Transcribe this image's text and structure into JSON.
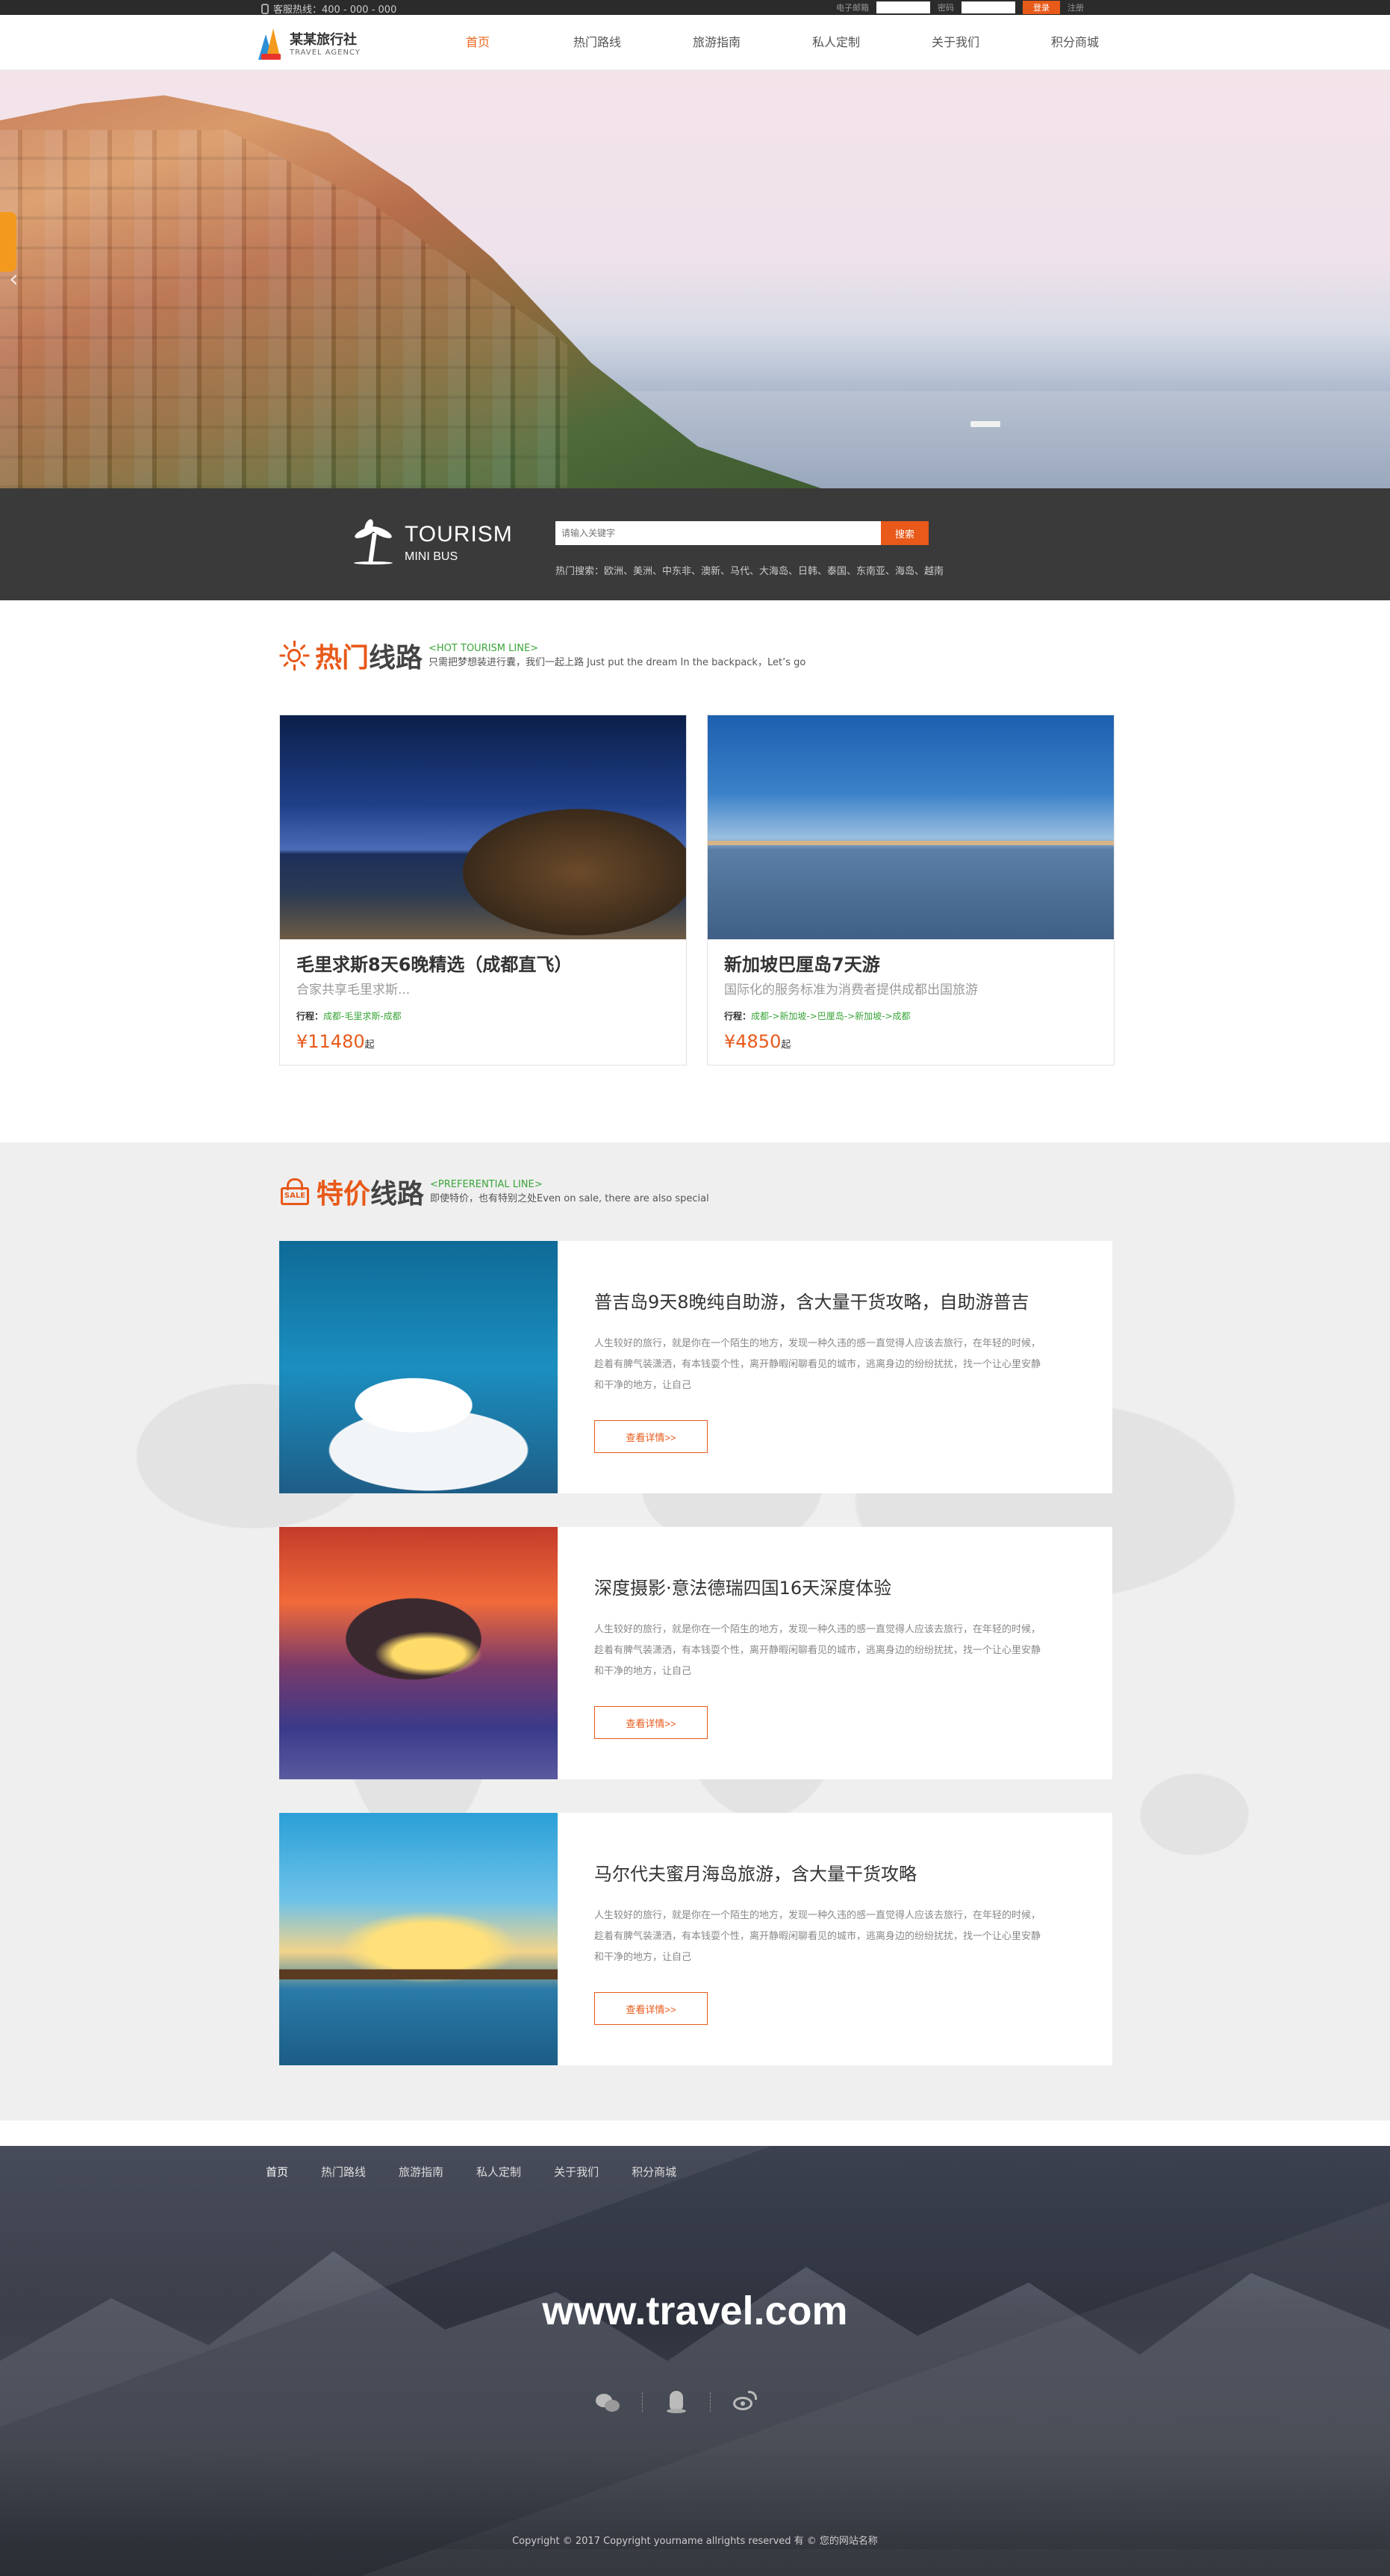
{
  "topbar": {
    "hotline": "客服热线：400 - 000 - 000",
    "email_label": "电子邮箱",
    "password_label": "密码",
    "login_label": "登录",
    "register_label": "注册"
  },
  "header": {
    "logo_cn": "某某旅行社",
    "logo_en": "TRAVEL AGENCY",
    "nav": [
      "首页",
      "热门路线",
      "旅游指南",
      "私人定制",
      "关于我们",
      "积分商城"
    ],
    "active_index": 0,
    "accent": "#e8681f"
  },
  "search": {
    "brand_title": "TOURISM",
    "brand_sub": "MINI BUS",
    "placeholder": "请输入关键字",
    "button": "搜索",
    "hot_label": "热门搜索：欧洲、美洲、中东非、澳新、马代、大海岛、日韩、泰国、东南亚、海岛、越南"
  },
  "hot_section": {
    "title_a": "热门",
    "title_b": "线路",
    "en": "<HOT TOURISM LINE>",
    "desc": "只需把梦想装进行囊，我们一起上路 Just put the dream In the backpack，Let’s go",
    "cards": [
      {
        "name": "毛里求斯8天6晚精选（成都直飞）",
        "desc": "合家共享毛里求斯...",
        "itin_label": "行程：",
        "itin": "成都-毛里求斯-成都",
        "price": "¥11480",
        "price_suffix": "起"
      },
      {
        "name": "新加坡巴厘岛7天游",
        "desc": "国际化的服务标准为消费者提供成都出国旅游",
        "itin_label": "行程：",
        "itin": "成都->新加坡->巴厘岛->新加坡->成都",
        "price": "¥4850",
        "price_suffix": "起"
      }
    ]
  },
  "pref_section": {
    "title_a": "特价",
    "title_b": "线路",
    "en": "<PREFERENTIAL LINE>",
    "desc": "即使特价，也有特别之处Even on sale, there are also special",
    "sale_badge": "SALE",
    "deals": [
      {
        "title": "普吉岛9天8晚纯自助游，含大量干货攻略，自助游普吉",
        "text": "人生较好的旅行，就是你在一个陌生的地方，发现一种久违的感一直觉得人应该去旅行，在年轻的时候，趁着有脾气装潇洒，有本钱耍个性，离开静暇闲聊看见的城市，逃离身边的纷纷扰扰，找一个让心里安静和干净的地方，让自己",
        "more": "查看详情>>"
      },
      {
        "title": "深度摄影·意法德瑞四国16天深度体验",
        "text": "人生较好的旅行，就是你在一个陌生的地方，发现一种久违的感一直觉得人应该去旅行，在年轻的时候，趁着有脾气装潇洒，有本钱耍个性，离开静暇闲聊看见的城市，逃离身边的纷纷扰扰，找一个让心里安静和干净的地方，让自己",
        "more": "查看详情>>"
      },
      {
        "title": "马尔代夫蜜月海岛旅游，含大量干货攻略",
        "text": "人生较好的旅行，就是你在一个陌生的地方，发现一种久违的感一直觉得人应该去旅行，在年轻的时候，趁着有脾气装潇洒，有本钱耍个性，离开静暇闲聊看见的城市，逃离身边的纷纷扰扰，找一个让心里安静和干净的地方，让自己",
        "more": "查看详情>>"
      }
    ]
  },
  "footer": {
    "nav": [
      "首页",
      "热门路线",
      "旅游指南",
      "私人定制",
      "关于我们",
      "积分商城"
    ],
    "site_url": "www.travel.com",
    "copyright": "Copyright © 2017 Copyright yourname allrights reserved 有 © 您的网站名称"
  }
}
